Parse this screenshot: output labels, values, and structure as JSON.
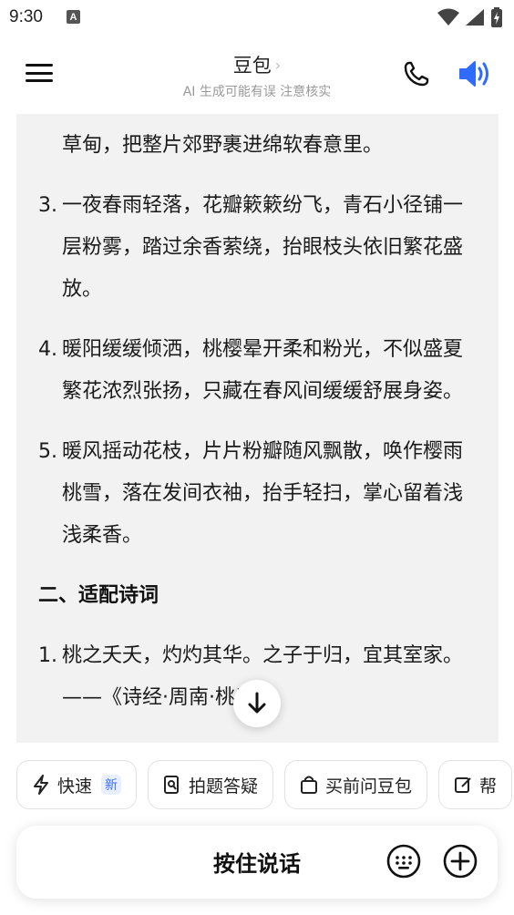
{
  "status_bar": {
    "time": "9:30",
    "notification_letter": "A"
  },
  "header": {
    "title": "豆包",
    "chevron": "›",
    "subtitle": "AI 生成可能有误 注意核实"
  },
  "content": {
    "top_continuation": "草甸，把整片郊野裹进绵软春意里。",
    "items": [
      {
        "num": "3.",
        "text": "一夜春雨轻落，花瓣簌簌纷飞，青石小径铺一层粉雾，踏过余香萦绕，抬眼枝头依旧繁花盛放。"
      },
      {
        "num": "4.",
        "text": "暖阳缓缓倾洒，桃樱晕开柔和粉光，不似盛夏繁花浓烈张扬，只藏在春风间缓缓舒展身姿。"
      },
      {
        "num": "5.",
        "text": "暖风摇动花枝，片片粉瓣随风飘散，唤作樱雨桃雪，落在发间衣袖，抬手轻扫，掌心留着浅浅柔香。"
      }
    ],
    "section_title": "二、适配诗词",
    "poem_items": [
      {
        "num": "1.",
        "text": "桃之夭夭，灼灼其华。之子于归，宜其室家。——《诗经·周南·桃夭》"
      }
    ]
  },
  "chips": [
    {
      "label": "快速",
      "badge": "新",
      "icon": "lightning-icon"
    },
    {
      "label": "拍题答疑",
      "icon": "photo-search-icon"
    },
    {
      "label": "买前问豆包",
      "icon": "shopping-bag-icon"
    },
    {
      "label": "帮",
      "icon": "edit-icon"
    }
  ],
  "input_bar": {
    "hold_to_talk": "按住说话"
  },
  "colors": {
    "accent_blue": "#2f6bff",
    "card_bg": "#f2f2f2"
  }
}
